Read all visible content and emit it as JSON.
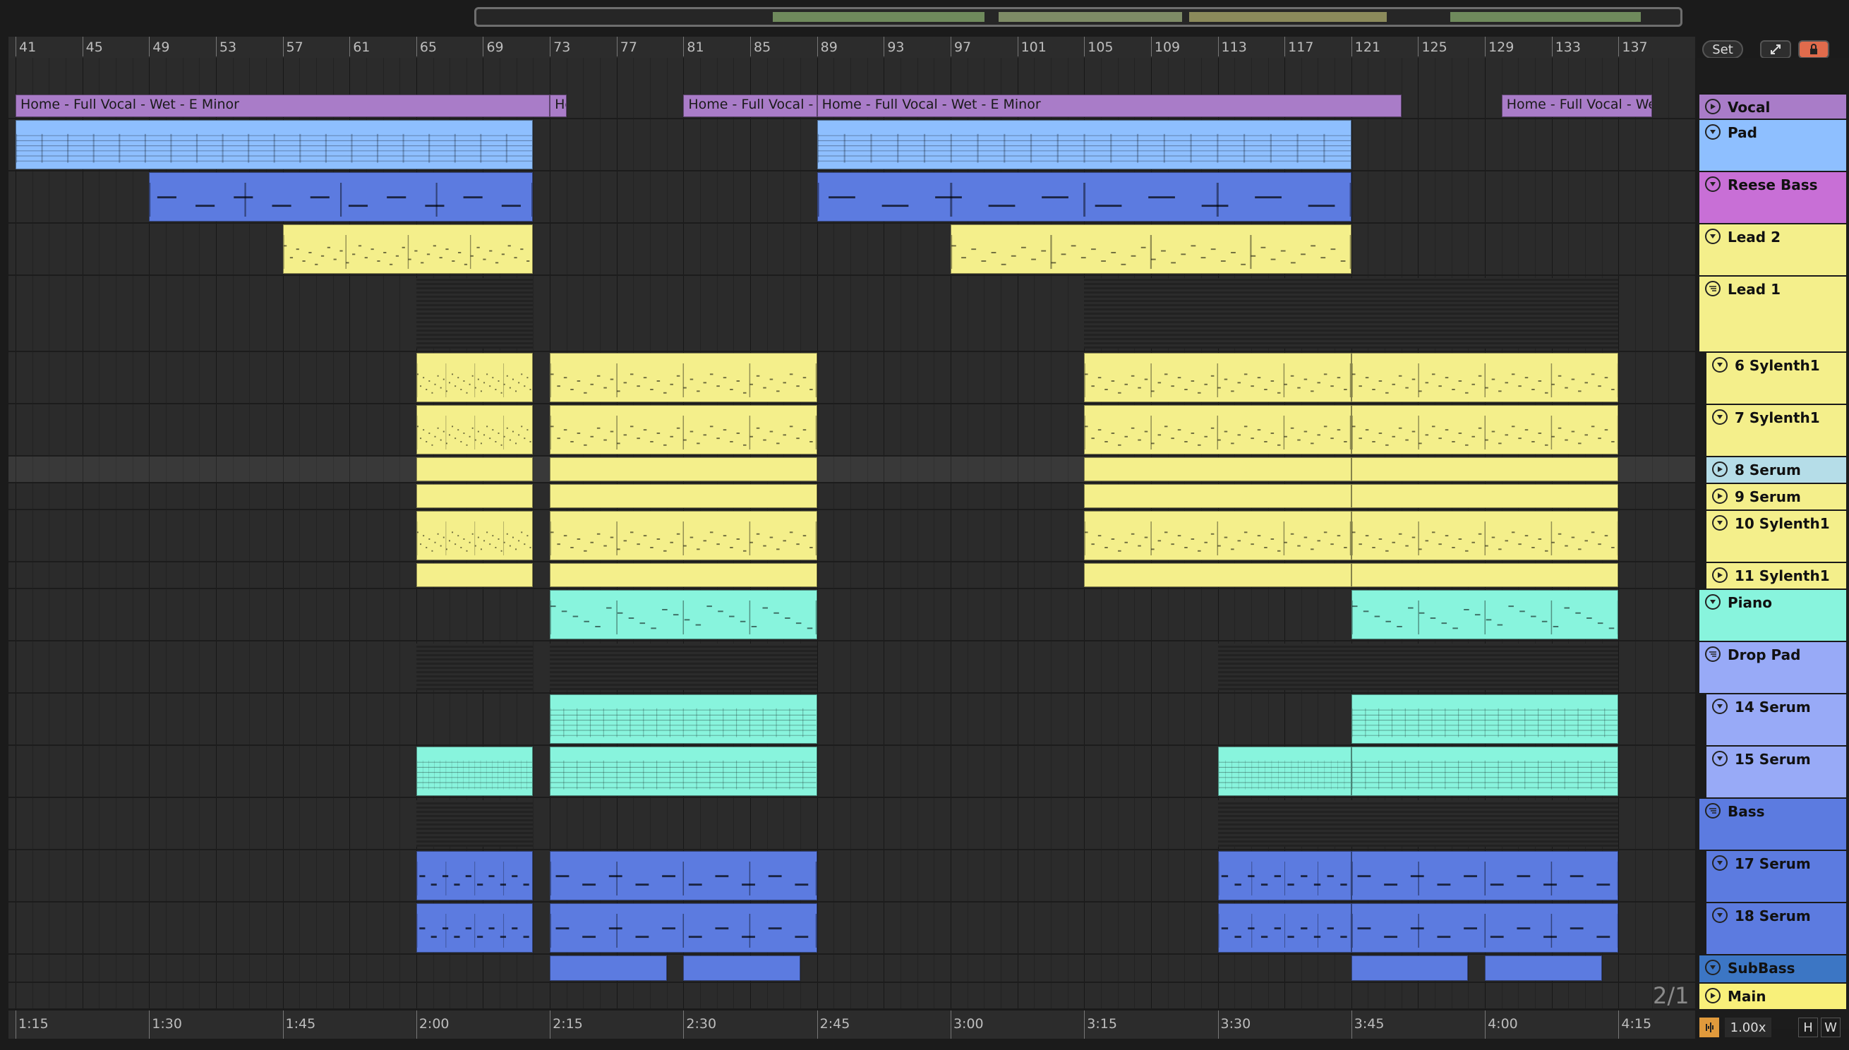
{
  "overview": {
    "segments": [
      {
        "color": "#6f8a5c"
      },
      {
        "color": "#7e8b66"
      },
      {
        "color": "#8b8a5b"
      },
      {
        "color": "#6f8a5c"
      }
    ]
  },
  "ruler": {
    "bars": [
      "41",
      "45",
      "49",
      "53",
      "57",
      "61",
      "65",
      "69",
      "73",
      "77",
      "81",
      "85",
      "89",
      "93",
      "97",
      "101",
      "105",
      "109",
      "113",
      "117",
      "121",
      "125",
      "129",
      "133",
      "137"
    ]
  },
  "time_ruler": {
    "labels": [
      "1:15",
      "1:30",
      "1:45",
      "2:00",
      "2:15",
      "2:30",
      "2:45",
      "3:00",
      "3:15",
      "3:30",
      "3:45",
      "4:00",
      "4:15"
    ]
  },
  "top_controls": {
    "set_label": "Set",
    "expand_icon": "expand-icon",
    "lock_icon": "lock-icon",
    "back_icon": "arrow-left-icon",
    "forward_icon": "arrow-right-icon"
  },
  "clips": {
    "vocal_1": "Home - Full Vocal - Wet - E Minor",
    "vocal_2": "Ho",
    "vocal_3": "Home - Full Vocal - We",
    "vocal_4": "Home - Full Vocal - Wet - E Minor",
    "vocal_5": "Home - Full Vocal - Wet -"
  },
  "tracks": [
    {
      "name": "Vocal",
      "color": "#a97cc8",
      "icon": "play-icon",
      "group": false
    },
    {
      "name": "Pad",
      "color": "#8ebfff",
      "icon": "fold-down-icon",
      "group": false
    },
    {
      "name": "Reese Bass",
      "color": "#c86fd6",
      "icon": "fold-down-icon",
      "group": false
    },
    {
      "name": "Lead 2",
      "color": "#f4ef8b",
      "icon": "fold-down-icon",
      "group": false
    },
    {
      "name": "Lead 1",
      "color": "#f4ef8b",
      "icon": "group-icon",
      "group": true
    },
    {
      "name": "6 Sylenth1",
      "color": "#f4ef8b",
      "icon": "fold-down-icon",
      "group": false
    },
    {
      "name": "7 Sylenth1",
      "color": "#f4ef8b",
      "icon": "fold-down-icon",
      "group": false
    },
    {
      "name": "8 Serum",
      "color": "#b5dde8",
      "icon": "play-icon",
      "group": false
    },
    {
      "name": "9 Serum",
      "color": "#f4ef8b",
      "icon": "play-icon",
      "group": false
    },
    {
      "name": "10 Sylenth1",
      "color": "#f4ef8b",
      "icon": "fold-down-icon",
      "group": false
    },
    {
      "name": "11 Sylenth1",
      "color": "#f4ef8b",
      "icon": "play-icon",
      "group": false
    },
    {
      "name": "Piano",
      "color": "#88f4dd",
      "icon": "fold-down-icon",
      "group": false
    },
    {
      "name": "Drop Pad",
      "color": "#98aaf7",
      "icon": "group-icon",
      "group": true
    },
    {
      "name": "14 Serum",
      "color": "#98aaf7",
      "icon": "fold-down-icon",
      "group": false
    },
    {
      "name": "15 Serum",
      "color": "#98aaf7",
      "icon": "fold-down-icon",
      "group": false
    },
    {
      "name": "Bass",
      "color": "#5c7be0",
      "icon": "group-icon",
      "group": true
    },
    {
      "name": "17 Serum",
      "color": "#5c7be0",
      "icon": "fold-down-icon",
      "group": false
    },
    {
      "name": "18 Serum",
      "color": "#5c7be0",
      "icon": "fold-down-icon",
      "group": false
    },
    {
      "name": "SubBass",
      "color": "#3c76c4",
      "icon": "fold-down-icon",
      "group": false
    },
    {
      "name": "Main",
      "color": "#f8f07a",
      "icon": "play-icon",
      "group": false
    }
  ],
  "status": {
    "zoom_ratio": "2/1",
    "tempo_factor": "1.00x",
    "h_label": "H",
    "w_label": "W"
  },
  "colors": {
    "vocal": "#a97cc8",
    "pad": "#8ebfff",
    "reese": "#5c7be0",
    "yellow": "#f4ef8b",
    "cyan": "#88f4dd",
    "blue": "#5c7be0"
  }
}
